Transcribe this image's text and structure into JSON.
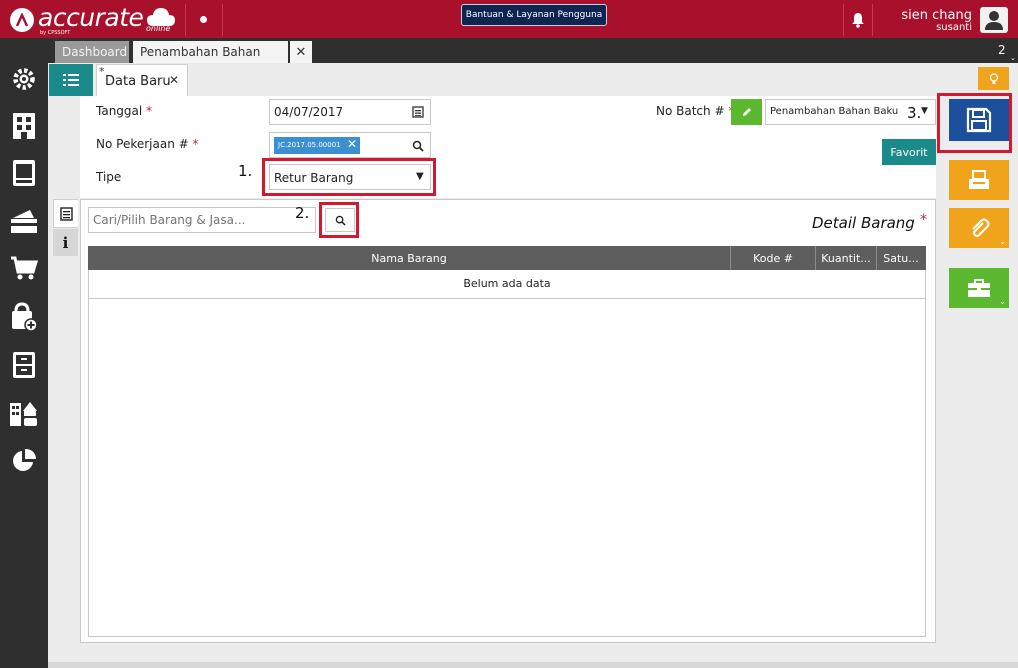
{
  "app": {
    "logo_text": "accurate",
    "logo_sub": "online",
    "logo_tag": "by CPSSOFT",
    "help_button": "Bantuan & Layanan Pengguna",
    "user_name": "sien chang",
    "user_sub": "susanti"
  },
  "tabs": [
    {
      "label": "Dashboard"
    },
    {
      "label": "Penambahan Bahan Baku"
    }
  ],
  "tab_count": "2",
  "form_tab": {
    "label": "Data Baru",
    "modified_mark": "*"
  },
  "form": {
    "tanggal_label": "Tanggal",
    "tanggal_value": "04/07/2017",
    "no_pekerjaan_label": "No Pekerjaan #",
    "no_pekerjaan_tag": "JC.2017.05.00001",
    "tipe_label": "Tipe",
    "tipe_value": "Retur Barang",
    "no_batch_label": "No Batch #",
    "no_batch_value": "Penambahan Bahan Baku",
    "favorit_label": "Favorit",
    "required_mark": "*"
  },
  "detail": {
    "search_placeholder": "Cari/Pilih Barang & Jasa...",
    "title": "Detail Barang",
    "columns": [
      "Nama Barang",
      "Kode #",
      "Kuantit...",
      "Satu..."
    ],
    "empty_text": "Belum ada data"
  },
  "annotations": [
    "1.",
    "2.",
    "3."
  ],
  "colors": {
    "brand_red": "#a8102c",
    "dark": "#2f2f2f",
    "teal": "#1a8a8a",
    "navy": "#1c4f9c",
    "orange": "#f0a41c",
    "green": "#5cb82e",
    "highlight_red": "#d11a2f"
  }
}
